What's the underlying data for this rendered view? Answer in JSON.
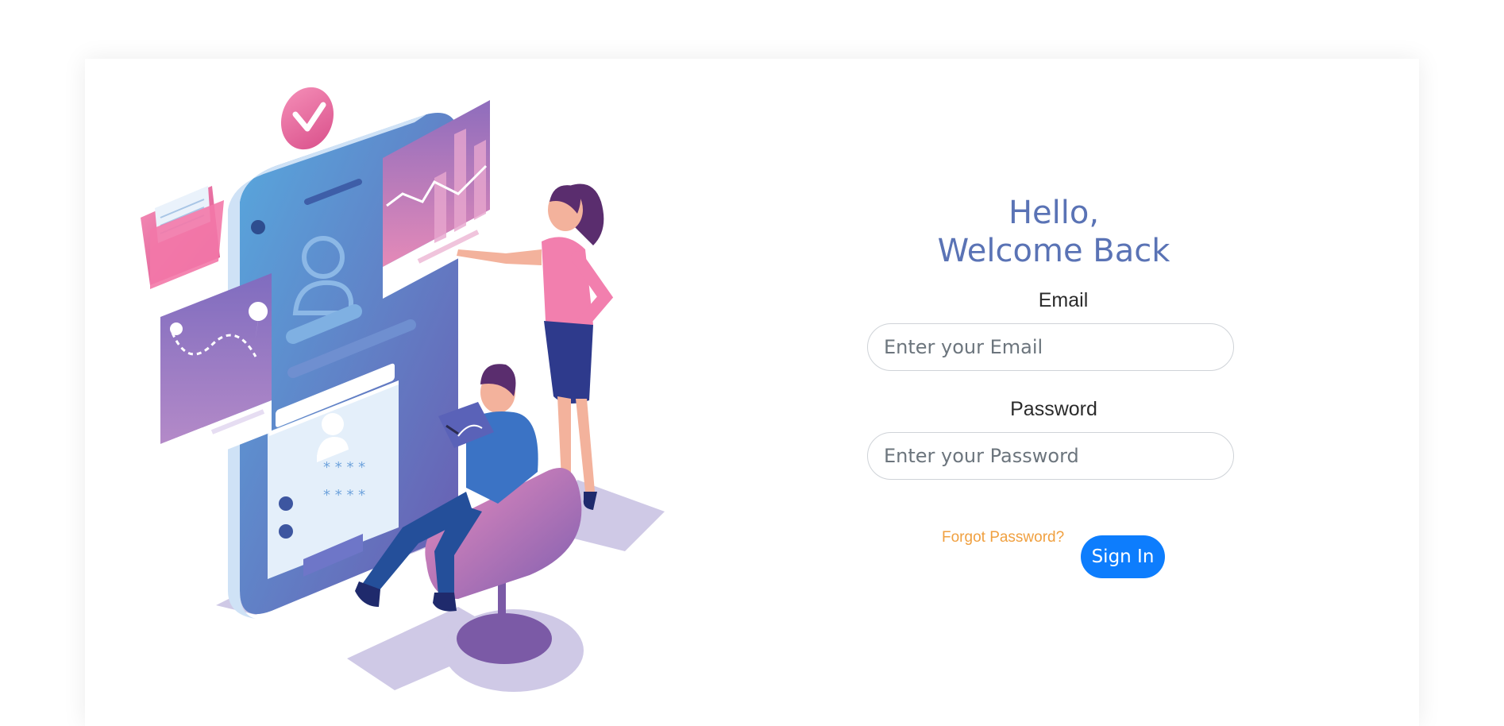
{
  "greeting": {
    "line1": "Hello,",
    "line2": "Welcome Back"
  },
  "form": {
    "email_label": "Email",
    "email_placeholder": "Enter your Email",
    "password_label": "Password",
    "password_placeholder": "Enter your Password",
    "forgot_password": "Forgot Password?",
    "sign_in": "Sign In"
  },
  "illustration": {
    "description_icons": [
      "checkmark-badge-icon",
      "folder-icon",
      "chart-card-icon",
      "map-route-card-icon",
      "user-profile-icon",
      "login-form-card-icon",
      "tablet-icon",
      "chair-icon"
    ]
  },
  "colors": {
    "accent": "#5a73b5",
    "button": "#0d7dfd",
    "link": "#f0a040"
  }
}
